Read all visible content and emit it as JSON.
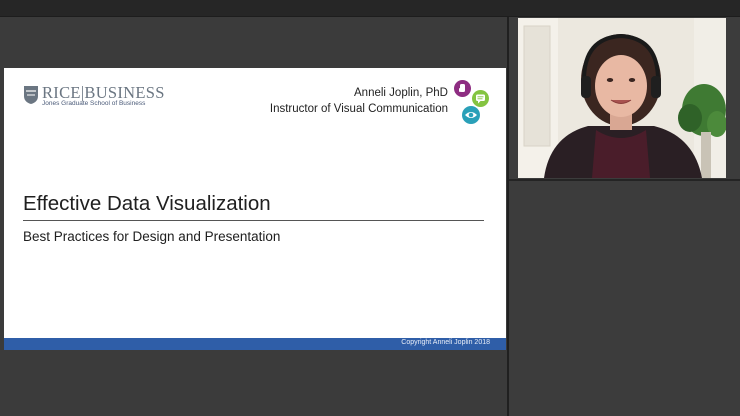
{
  "slide": {
    "logo_main": "RICE|BUSINESS",
    "logo_sub": "Jones Graduate School of Business",
    "instructor_name": "Anneli Joplin, PhD",
    "instructor_title": "Instructor of Visual Communication",
    "title": "Effective Data Visualization",
    "subtitle": "Best Practices for Design and Presentation",
    "footer": "Copyright Anneli Joplin 2018",
    "icons": [
      "hand-icon",
      "speech-bubble-icon",
      "eye-icon"
    ]
  },
  "colors": {
    "footer_bar": "#2f5ea8",
    "badge_purple": "#8e2d82",
    "badge_green": "#84c441",
    "badge_teal": "#2aa0b8"
  }
}
